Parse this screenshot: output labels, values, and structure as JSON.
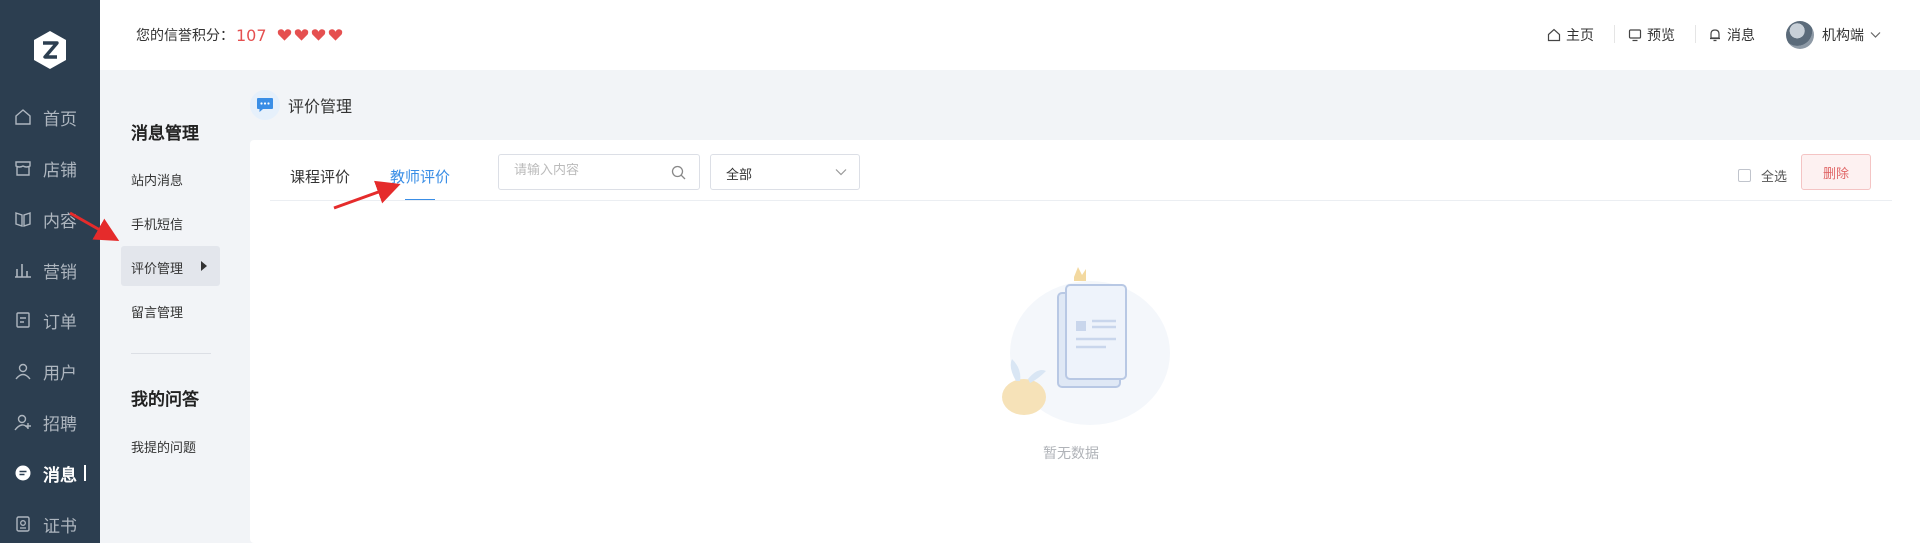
{
  "header": {
    "credit_label": "您的信誉积分：",
    "credit_score": "107",
    "links": {
      "home": "主页",
      "preview": "预览",
      "messages": "消息",
      "account": "机构端"
    }
  },
  "nav": {
    "items": [
      {
        "label": "首页",
        "icon": "home-icon"
      },
      {
        "label": "店铺",
        "icon": "store-icon"
      },
      {
        "label": "内容",
        "icon": "book-icon"
      },
      {
        "label": "营销",
        "icon": "bar-chart-icon"
      },
      {
        "label": "订单",
        "icon": "document-icon"
      },
      {
        "label": "用户",
        "icon": "user-icon"
      },
      {
        "label": "招聘",
        "icon": "user-plus-icon"
      },
      {
        "label": "消息",
        "icon": "chat-icon"
      },
      {
        "label": "证书",
        "icon": "certificate-icon"
      }
    ],
    "active_index": 7
  },
  "subnav": {
    "section1_title": "消息管理",
    "items": [
      "站内消息",
      "手机短信",
      "评价管理",
      "留言管理"
    ],
    "active_index": 2,
    "section2_title": "我的问答",
    "section2_items": [
      "我提的问题"
    ]
  },
  "page": {
    "title": "评价管理",
    "tabs": [
      "课程评价",
      "教师评价"
    ],
    "active_tab": 1,
    "search_placeholder": "请输入内容",
    "filter_value": "全部",
    "select_all_label": "全选",
    "delete_label": "删除",
    "empty_text": "暂无数据"
  },
  "colors": {
    "nav_bg": "#2c3e50",
    "accent": "#3a8ee6",
    "danger": "#e06666",
    "credit": "#e55050"
  }
}
